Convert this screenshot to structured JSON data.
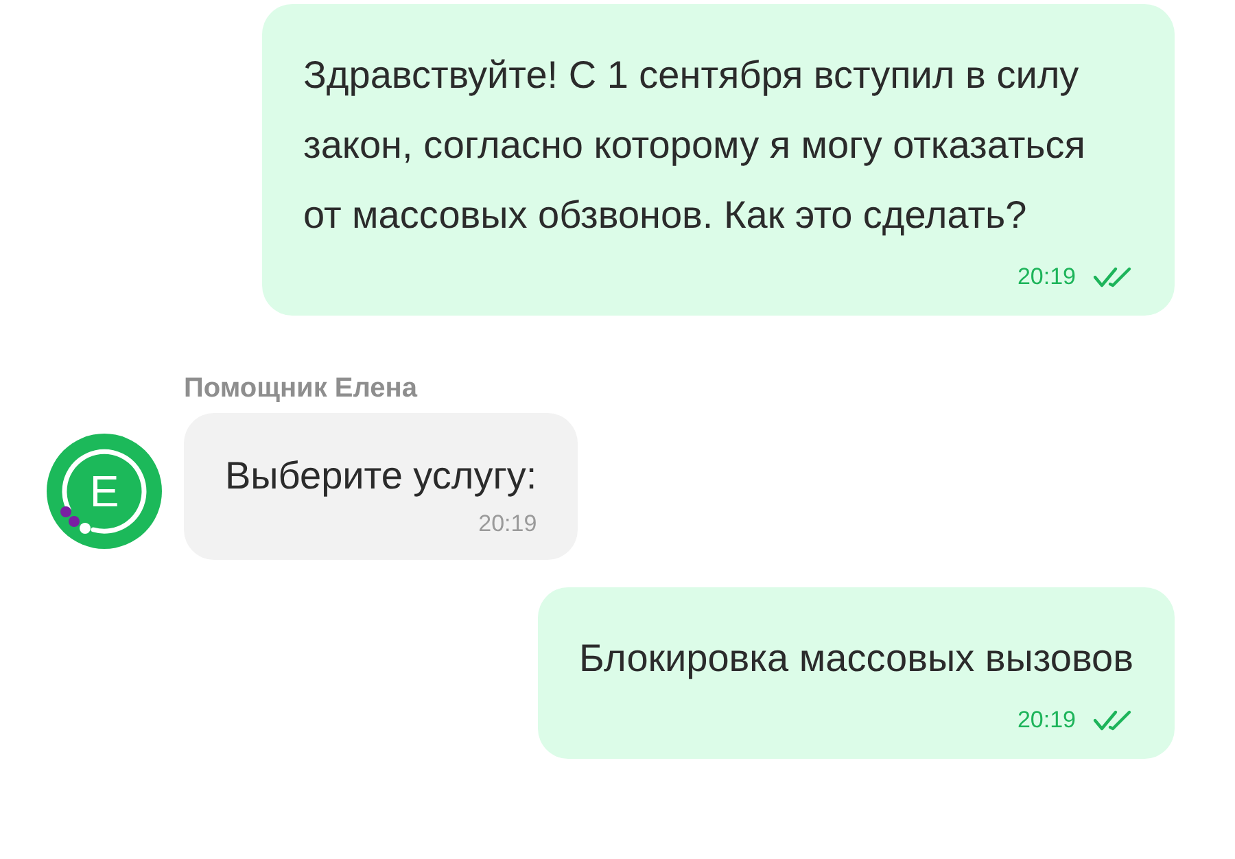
{
  "messages": [
    {
      "kind": "outgoing",
      "text": "Здравствуйте! С 1 сентября вступил в силу закон, согласно которому я могу отказаться от массовых обзвонов. Как это сделать?",
      "time": "20:19",
      "read": true
    },
    {
      "kind": "incoming",
      "sender": "Помощник Елена",
      "avatar_letter": "E",
      "text": "Выберите услугу:",
      "time": "20:19"
    },
    {
      "kind": "outgoing",
      "text": "Блокировка массовых вызовов",
      "time": "20:19",
      "read": true
    }
  ]
}
